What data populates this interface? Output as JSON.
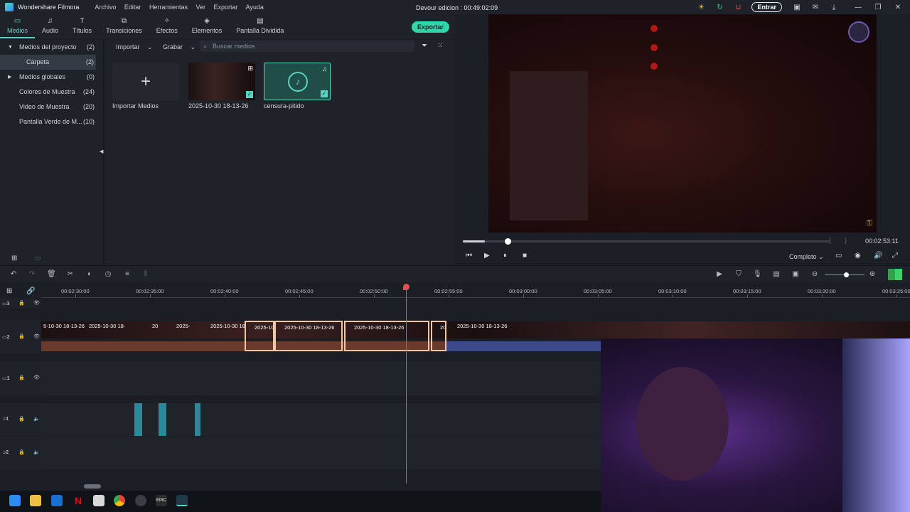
{
  "app": {
    "name": "Wondershare Filmora",
    "project_title": "Devour edicion : 00:49:02:09",
    "login_label": "Entrar"
  },
  "menu": [
    "Archivo",
    "Editar",
    "Herramientas",
    "Ver",
    "Exportar",
    "Ayuda"
  ],
  "tabs": [
    {
      "label": "Medios",
      "icon": "folder-icon"
    },
    {
      "label": "Audio",
      "icon": "music-icon"
    },
    {
      "label": "Títulos",
      "icon": "text-icon"
    },
    {
      "label": "Transiciones",
      "icon": "transition-icon"
    },
    {
      "label": "Efectos",
      "icon": "effects-icon"
    },
    {
      "label": "Elementos",
      "icon": "elements-icon"
    },
    {
      "label": "Pantalla Dividida",
      "icon": "split-screen-icon"
    }
  ],
  "export_label": "Exportar",
  "sidebar": [
    {
      "label": "Medios del proyecto",
      "count": "(2)"
    },
    {
      "label": "Carpeta",
      "count": "(2)"
    },
    {
      "label": "Medios globales",
      "count": "(0)"
    },
    {
      "label": "Colores de Muestra",
      "count": "(24)"
    },
    {
      "label": "Video de Muestra",
      "count": "(20)"
    },
    {
      "label": "Pantalla Verde de M...",
      "count": "(10)"
    }
  ],
  "media": {
    "import_label": "Importar",
    "record_label": "Grabar",
    "search_placeholder": "Buscar medios",
    "items": [
      {
        "label": "Importar Medios"
      },
      {
        "label": "2025-10-30 18-13-26"
      },
      {
        "label": "censura-pitido"
      }
    ]
  },
  "player": {
    "timecode": "00:02:53:11",
    "quality": "Completo",
    "progress": 0.06
  },
  "ruler": [
    "00:02:30:00",
    "00:02:35:00",
    "00:02:40:00",
    "00:02:45:00",
    "00:02:50:00",
    "00:02:55:00",
    "00:03:00:00",
    "00:03:05:00",
    "00:03:10:00",
    "00:03:15:00",
    "00:03:20:00",
    "00:03:25:00"
  ],
  "tracks": {
    "v3": "3",
    "v2": "2",
    "v1": "1",
    "a1": "1",
    "a2": "2"
  },
  "clips": [
    "5-10-30 18-13-26",
    "2025-10-30 18-",
    "20",
    "2025-",
    "2025-10-30 18",
    "2025-10",
    "2025-10-30 18-13-26",
    "2025-10-30 18-13-26",
    "20",
    "2025-10-30 18-13-26"
  ],
  "colors": {
    "accent": "#57d4c1",
    "export": "#2fd6a9",
    "playhead": "#e05252",
    "clip_border": "#f0c7a6"
  }
}
